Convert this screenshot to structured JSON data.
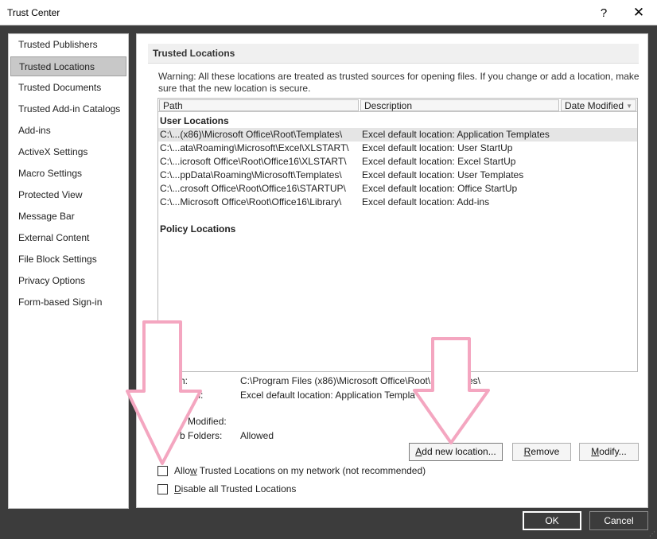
{
  "window": {
    "title": "Trust Center",
    "help_glyph": "?",
    "close_glyph": "✕"
  },
  "sidebar": {
    "items": [
      {
        "label": "Trusted Publishers",
        "active": false
      },
      {
        "label": "Trusted Locations",
        "active": true
      },
      {
        "label": "Trusted Documents",
        "active": false
      },
      {
        "label": "Trusted Add-in Catalogs",
        "active": false
      },
      {
        "label": "Add-ins",
        "active": false
      },
      {
        "label": "ActiveX Settings",
        "active": false
      },
      {
        "label": "Macro Settings",
        "active": false
      },
      {
        "label": "Protected View",
        "active": false
      },
      {
        "label": "Message Bar",
        "active": false
      },
      {
        "label": "External Content",
        "active": false
      },
      {
        "label": "File Block Settings",
        "active": false
      },
      {
        "label": "Privacy Options",
        "active": false
      },
      {
        "label": "Form-based Sign-in",
        "active": false
      }
    ]
  },
  "main": {
    "section_title": "Trusted Locations",
    "warning": "Warning: All these locations are treated as trusted sources for opening files.  If you change or add a location, make sure that the new location is secure.",
    "table": {
      "columns": [
        "Path",
        "Description",
        "Date Modified"
      ],
      "sort_glyph": "▼",
      "user_group_label": "User Locations",
      "policy_group_label": "Policy Locations",
      "rows": [
        {
          "path": "C:\\...(x86)\\Microsoft Office\\Root\\Templates\\",
          "description": "Excel default location: Application Templates",
          "selected": true
        },
        {
          "path": "C:\\...ata\\Roaming\\Microsoft\\Excel\\XLSTART\\",
          "description": "Excel default location: User StartUp",
          "selected": false
        },
        {
          "path": "C:\\...icrosoft Office\\Root\\Office16\\XLSTART\\",
          "description": "Excel default location: Excel StartUp",
          "selected": false
        },
        {
          "path": "C:\\...ppData\\Roaming\\Microsoft\\Templates\\",
          "description": "Excel default location: User Templates",
          "selected": false
        },
        {
          "path": "C:\\...crosoft Office\\Root\\Office16\\STARTUP\\",
          "description": "Excel default location: Office StartUp",
          "selected": false
        },
        {
          "path": "C:\\...Microsoft Office\\Root\\Office16\\Library\\",
          "description": "Excel default location: Add-ins",
          "selected": false
        }
      ]
    },
    "details": {
      "path_label": "h:",
      "path_value": "C:\\Program Files (x86)\\Microsoft Office\\Root\\",
      "path_value_tail": "es\\",
      "description_label": "ption:",
      "description_value": "Excel default location: Application Templa",
      "date_label": "e Modified:",
      "subfolders_label": "b Folders:",
      "subfolders_value": "Allowed"
    },
    "buttons": {
      "add_pre": "",
      "add_underline": "A",
      "add_post": "dd new location...",
      "remove_pre": "",
      "remove_underline": "R",
      "remove_post": "emove",
      "modify_pre": "",
      "modify_underline": "M",
      "modify_post": "odify..."
    },
    "checkboxes": {
      "network_pre": "Allo",
      "network_underline": "w",
      "network_post": " Trusted Locations on my network (not recommended)",
      "network_checked": false,
      "disable_pre": "",
      "disable_underline": "D",
      "disable_post": "isable all Trusted Locations",
      "disable_checked": false
    }
  },
  "footer": {
    "ok_label": "OK",
    "cancel_label": "Cancel",
    "grip_glyph": "⋰"
  },
  "annotations": {
    "arrow_color": "#f4a6c0"
  }
}
